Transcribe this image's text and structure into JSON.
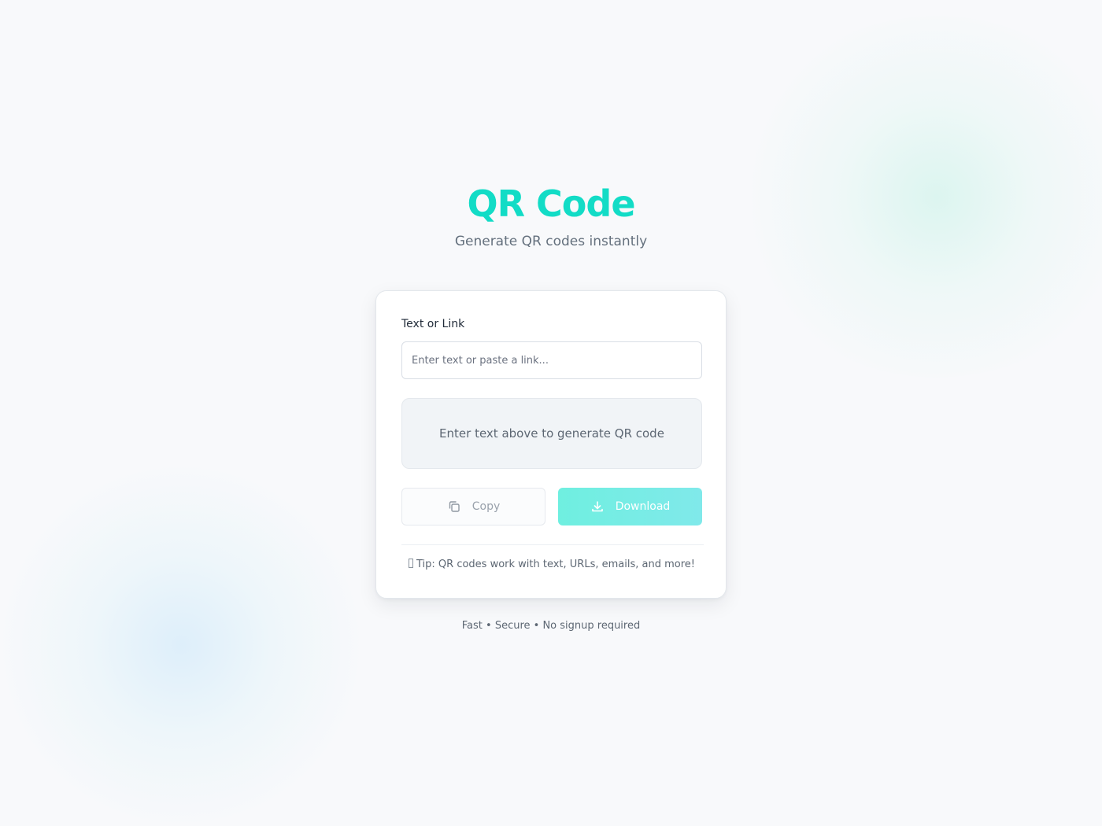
{
  "header": {
    "title": "QR Code",
    "subtitle": "Generate QR codes instantly"
  },
  "form": {
    "label": "Text or Link",
    "input_placeholder": "Enter text or paste a link...",
    "input_value": ""
  },
  "preview": {
    "placeholder_text": "Enter text above to generate QR code"
  },
  "actions": {
    "copy_label": "Copy",
    "copy_icon": "copy-icon",
    "download_label": "Download",
    "download_icon": "download-icon"
  },
  "tip": {
    "text": "Tip: QR codes work with text, URLs, emails, and more!"
  },
  "footer": {
    "text": "Fast • Secure • No signup required"
  },
  "colors": {
    "accent": "#12dcc6",
    "download_button": "#75ece4",
    "background": "#f8f9fb"
  }
}
